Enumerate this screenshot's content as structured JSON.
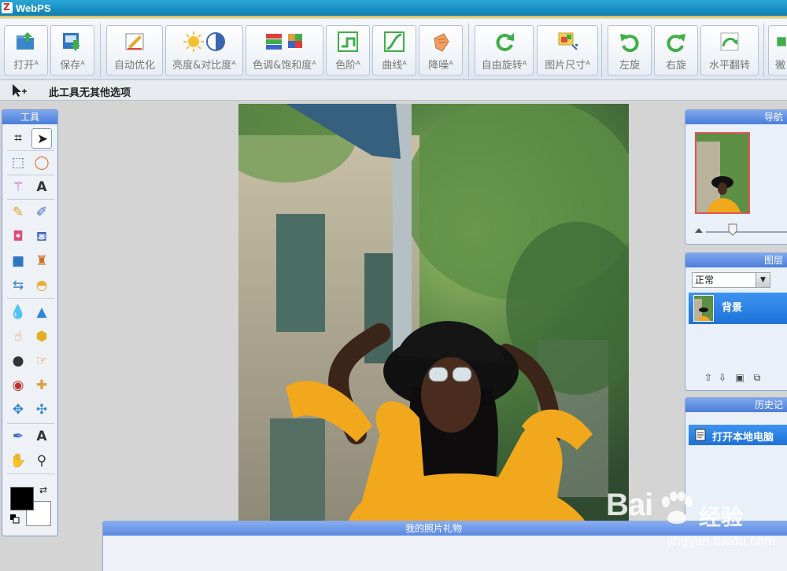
{
  "app": {
    "title": "WebPS"
  },
  "toolbar": {
    "buttons": [
      {
        "label": "打开ᴬ",
        "icon": "open-folder-icon"
      },
      {
        "label": "保存ᴬ",
        "icon": "save-icon"
      },
      {
        "label": "自动优化",
        "icon": "auto-enhance-icon"
      },
      {
        "label": "亮度&对比度ᴬ",
        "icon": "brightness-contrast-icon"
      },
      {
        "label": "色调&饱和度ᴬ",
        "icon": "hue-saturation-icon"
      },
      {
        "label": "色阶ᴬ",
        "icon": "levels-icon"
      },
      {
        "label": "曲线ᴬ",
        "icon": "curves-icon"
      },
      {
        "label": "降噪ᴬ",
        "icon": "denoise-icon"
      },
      {
        "label": "自由旋转ᴬ",
        "icon": "free-rotate-icon"
      },
      {
        "label": "图片尺寸ᴬ",
        "icon": "image-size-icon"
      },
      {
        "label": "左旋",
        "icon": "rotate-left-icon"
      },
      {
        "label": "右旋",
        "icon": "rotate-right-icon"
      },
      {
        "label": "水平翻转",
        "icon": "flip-horizontal-icon"
      },
      {
        "label": "徶",
        "icon": "more-icon"
      }
    ]
  },
  "optionbar": {
    "text": "此工具无其他选项"
  },
  "tools_panel": {
    "title": "工具"
  },
  "navigator": {
    "title": "导航"
  },
  "layers": {
    "title": "图层",
    "blend_mode": "正常",
    "layer_name": "背景"
  },
  "history": {
    "title": "历史记",
    "item": "打开本地电脑"
  },
  "gift_panel": {
    "title": "我的照片礼物"
  },
  "watermark": {
    "brand": "Bai",
    "cn": "经验",
    "url": "jingyan.baidu.com"
  },
  "colors": {
    "accent": "#1e72d8",
    "titlebar": "#0c7fb5",
    "panel_head": "#4b7ed9"
  }
}
